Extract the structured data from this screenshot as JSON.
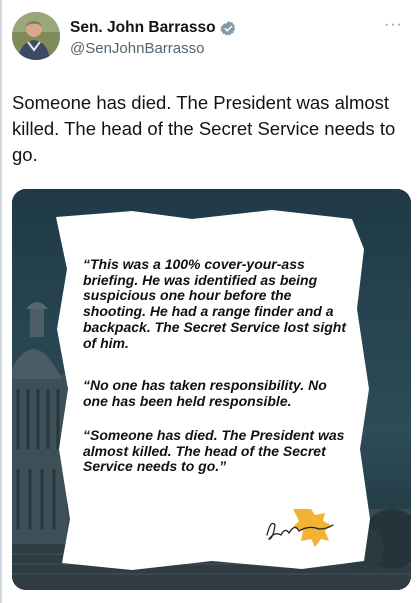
{
  "author": {
    "display_name": "Sen. John Barrasso",
    "handle": "@SenJohnBarrasso",
    "verified_color": "#829aab",
    "avatar_icon": "avatar-photo"
  },
  "menu": {
    "more_icon": "more-horizontal-icon"
  },
  "tweet": {
    "text": "Someone has died. The President was almost killed. The head of the Secret Service needs to go."
  },
  "image": {
    "quotes": [
      "“This was a 100% cover-your-ass briefing. He was identified as being suspicious one hour before the shooting. He had a range finder and a backpack. The Secret Service lost sight of him.",
      "“No one has taken responsibility. No one has been held responsible.",
      "“Someone has died. The President was almost killed. The head of the Secret Service needs to go.”"
    ],
    "signature_icon": "signature-with-bronco-logo",
    "background_colors": {
      "sky": "#223f4b",
      "building": "#3a4a52",
      "logo_gold": "#f2b233"
    }
  }
}
